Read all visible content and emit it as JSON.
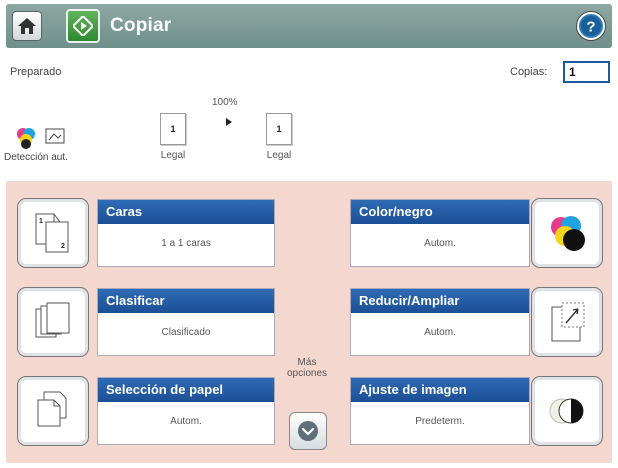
{
  "header": {
    "title": "Copiar",
    "home_icon": "home-icon",
    "copy_icon": "copy-start-icon",
    "help_icon": "help-icon",
    "bar_color": "#7a9893",
    "start_color": "#3e9a3c"
  },
  "status": {
    "state": "Preparado",
    "copies_label": "Copias:",
    "copies_value": "1"
  },
  "preview": {
    "zoom": "100%",
    "source_page": "1",
    "source_label": "Legal",
    "output_page": "1",
    "output_label": "Legal",
    "detection_label": "Detección aut."
  },
  "tiles": {
    "caras": {
      "title": "Caras",
      "value": "1 a 1 caras",
      "icon": "duplex-icon"
    },
    "color": {
      "title": "Color/negro",
      "value": "Autom.",
      "icon": "color-mode-icon"
    },
    "clasificar": {
      "title": "Clasificar",
      "value": "Clasificado",
      "icon": "collate-icon"
    },
    "reducir": {
      "title": "Reducir/Ampliar",
      "value": "Autom.",
      "icon": "resize-icon"
    },
    "papel": {
      "title": "Selección de papel",
      "value": "Autom.",
      "icon": "paper-select-icon"
    },
    "ajuste": {
      "title": "Ajuste de imagen",
      "value": "Predeterm.",
      "icon": "image-adjust-icon"
    }
  },
  "more": {
    "label_line1": "Más",
    "label_line2": "opciones",
    "icon": "chevron-down-icon"
  },
  "colors": {
    "panel_bg": "#f4d7cf",
    "tile_header": "#245fa8",
    "copies_border": "#1f5aa0"
  }
}
